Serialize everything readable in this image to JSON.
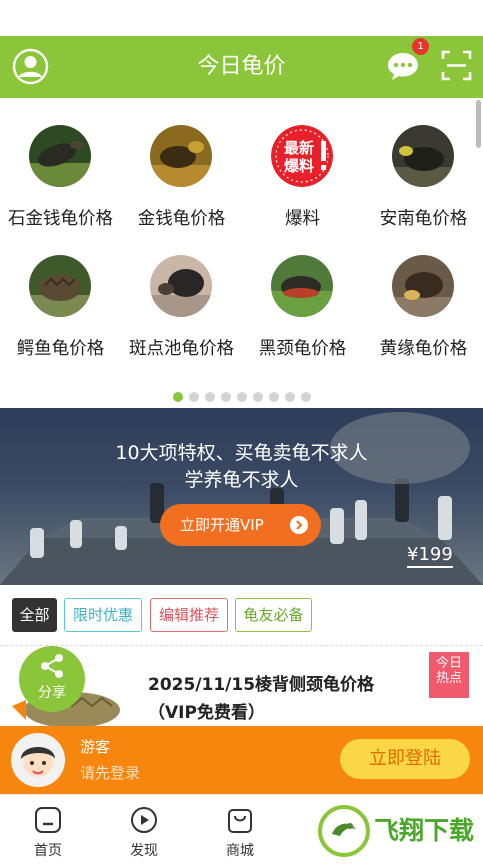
{
  "header": {
    "title": "今日龟价",
    "message_badge": "1"
  },
  "categories": [
    {
      "label": "石金钱龟价格",
      "icon": "turtle-photo-icon"
    },
    {
      "label": "金钱龟价格",
      "icon": "turtle-photo-icon"
    },
    {
      "label": "爆料",
      "icon": "news-badge-icon",
      "badge_text_1": "最新",
      "badge_text_2": "爆料"
    },
    {
      "label": "安南龟价格",
      "icon": "turtle-photo-icon"
    },
    {
      "label": "鳄鱼龟价格",
      "icon": "turtle-photo-icon"
    },
    {
      "label": "斑点池龟价格",
      "icon": "turtle-photo-icon"
    },
    {
      "label": "黑颈龟价格",
      "icon": "turtle-photo-icon"
    },
    {
      "label": "黄缘龟价格",
      "icon": "turtle-photo-icon"
    }
  ],
  "pager": {
    "count": 9,
    "active": 0
  },
  "banner": {
    "line1": "10大项特权、买龟卖龟不求人",
    "line2": "学养龟不求人",
    "button": "立即开通VIP",
    "price": "¥199"
  },
  "tags": [
    "全部",
    "限时优惠",
    "编辑推荐",
    "龟友必备"
  ],
  "article": {
    "title_line1": "2025/11/15棱背侧颈龟价格",
    "title_line2": "（VIP免费看）",
    "hot_line1": "今日",
    "hot_line2": "热点"
  },
  "share": {
    "label": "分享"
  },
  "login": {
    "name": "游客",
    "hint": "请先登录",
    "button": "立即登陆"
  },
  "nav": [
    {
      "label": "首页",
      "icon": "home-icon"
    },
    {
      "label": "发现",
      "icon": "play-icon"
    },
    {
      "label": "商城",
      "icon": "shopping-bag-icon"
    },
    {
      "label": "",
      "icon": ""
    },
    {
      "label": "",
      "icon": ""
    }
  ],
  "watermark": {
    "text": "飞翔下载"
  },
  "colors": {
    "brand_green": "#8bc63a",
    "orange": "#f7860f",
    "vip_orange": "#f26f21",
    "hot_pink": "#f05a6c"
  }
}
